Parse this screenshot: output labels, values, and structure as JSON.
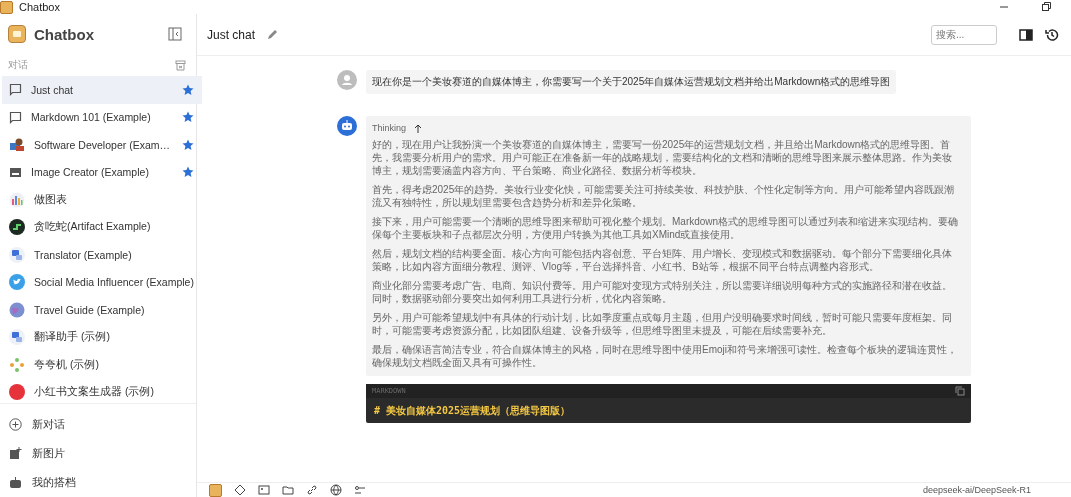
{
  "window": {
    "title": "Chatbox"
  },
  "sidebar": {
    "brand": "Chatbox",
    "section_label": "对话",
    "conversations": [
      {
        "name": "Just chat",
        "kind": "chat",
        "starred": true,
        "selected": true
      },
      {
        "name": "Markdown 101 (Example)",
        "kind": "chat",
        "starred": true,
        "selected": false
      },
      {
        "name": "Software Developer (Exam…",
        "kind": "developer",
        "starred": true,
        "selected": false
      },
      {
        "name": "Image Creator (Example)",
        "kind": "image",
        "starred": true,
        "selected": false
      },
      {
        "name": "做图表",
        "kind": "chart",
        "starred": false,
        "selected": false
      },
      {
        "name": "贪吃蛇(Artifact Example)",
        "kind": "snake",
        "starred": false,
        "selected": false
      },
      {
        "name": "Translator (Example)",
        "kind": "translate",
        "starred": false,
        "selected": false
      },
      {
        "name": "Social Media Influencer (Example)",
        "kind": "bird",
        "starred": false,
        "selected": false
      },
      {
        "name": "Travel Guide (Example)",
        "kind": "globe",
        "starred": false,
        "selected": false
      },
      {
        "name": "翻译助手 (示例)",
        "kind": "translate",
        "starred": false,
        "selected": false
      },
      {
        "name": "夸夸机 (示例)",
        "kind": "flower",
        "starred": false,
        "selected": false
      },
      {
        "name": "小红书文案生成器 (示例)",
        "kind": "badge",
        "starred": false,
        "selected": false
      }
    ],
    "footer": [
      {
        "label": "新对话",
        "kind": "plus"
      },
      {
        "label": "新图片",
        "kind": "image"
      },
      {
        "label": "我的搭档",
        "kind": "bot"
      }
    ]
  },
  "header": {
    "title": "Just chat",
    "search_placeholder": "搜索..."
  },
  "messages": [
    {
      "kind": "user",
      "text": "现在你是一个美妆赛道的自媒体博主，你需要写一个关于2025年自媒体运营规划文档并给出Markdown格式的思维导图"
    },
    {
      "kind": "assistant",
      "thinking_label": "Thinking",
      "thinking": [
        "好的，现在用户让我扮演一个美妆赛道的自媒体博主，需要写一份2025年的运营规划文档，并且给出Markdown格式的思维导图。首先，我需要分析用户的需求。用户可能正在准备新一年的战略规划，需要结构化的文档和清晰的思维导图来展示整体思路。作为美妆博主，规划需要涵盖内容方向、平台策略、商业化路径、数据分析等模块。",
        "首先，得考虑2025年的趋势。美妆行业变化快，可能需要关注可持续美妆、科技护肤、个性化定制等方向。用户可能希望内容既跟潮流又有独特性，所以规划里需要包含趋势分析和差异化策略。",
        "接下来，用户可能需要一个清晰的思维导图来帮助可视化整个规划。Markdown格式的思维导图可以通过列表和缩进来实现结构。要确保每个主要板块和子点都层次分明，方便用户转换为其他工具如XMind或直接使用。",
        "然后，规划文档的结构要全面。核心方向可能包括内容创意、平台矩阵、用户增长、变现模式和数据驱动。每个部分下需要细化具体策略，比如内容方面细分教程、测评、Vlog等，平台选择抖音、小红书、B站等，根据不同平台特点调整内容形式。",
        "商业化部分需要考虑广告、电商、知识付费等。用户可能对变现方式特别关注，所以需要详细说明每种方式的实施路径和潜在收益。同时，数据驱动部分要突出如何利用工具进行分析，优化内容策略。",
        "另外，用户可能希望规划中有具体的行动计划，比如季度重点或每月主题，但用户没明确要求时间线，暂时可能只需要年度框架。同时，可能需要考虑资源分配，比如团队组建、设备升级等，但思维导图里未提及，可能在后续需要补充。",
        "最后，确保语言简洁专业，符合自媒体博主的风格，同时在思维导图中使用Emoji和符号来增强可读性。检查每个板块的逻辑连贯性，确保规划文档既全面又具有可操作性。"
      ],
      "code": {
        "language": "MARKDOWN",
        "line": "# 美妆自媒体2025运营规划（思维导图版）"
      }
    }
  ],
  "toolbar": {
    "model": "deepseek-ai/DeepSeek-R1"
  }
}
